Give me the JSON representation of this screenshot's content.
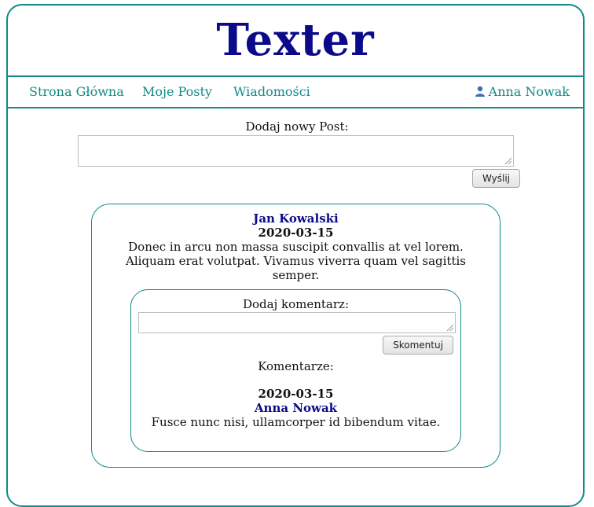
{
  "app": {
    "title": "Texter"
  },
  "nav": {
    "items": [
      {
        "label": "Strona Główna"
      },
      {
        "label": "Moje Posty"
      },
      {
        "label": "Wiadomości"
      }
    ],
    "user": {
      "name": "Anna Nowak",
      "icon": "user-icon"
    }
  },
  "new_post": {
    "label": "Dodaj nowy Post:",
    "value": "",
    "submit_label": "Wyślij"
  },
  "post": {
    "author": "Jan Kowalski",
    "date": "2020-03-15",
    "body": "Donec in arcu non massa suscipit convallis at vel lorem. Aliquam erat volutpat. Vivamus viverra quam vel sagittis semper.",
    "comment_form": {
      "label": "Dodaj komentarz:",
      "value": "",
      "submit_label": "Skomentuj"
    },
    "comments_heading": "Komentarze:",
    "comments": [
      {
        "date": "2020-03-15",
        "author": "Anna Nowak",
        "text": "Fusce nunc nisi, ullamcorper id bibendum vitae."
      }
    ]
  },
  "colors": {
    "accent": "#138a88",
    "brand": "#0a0a8a"
  }
}
